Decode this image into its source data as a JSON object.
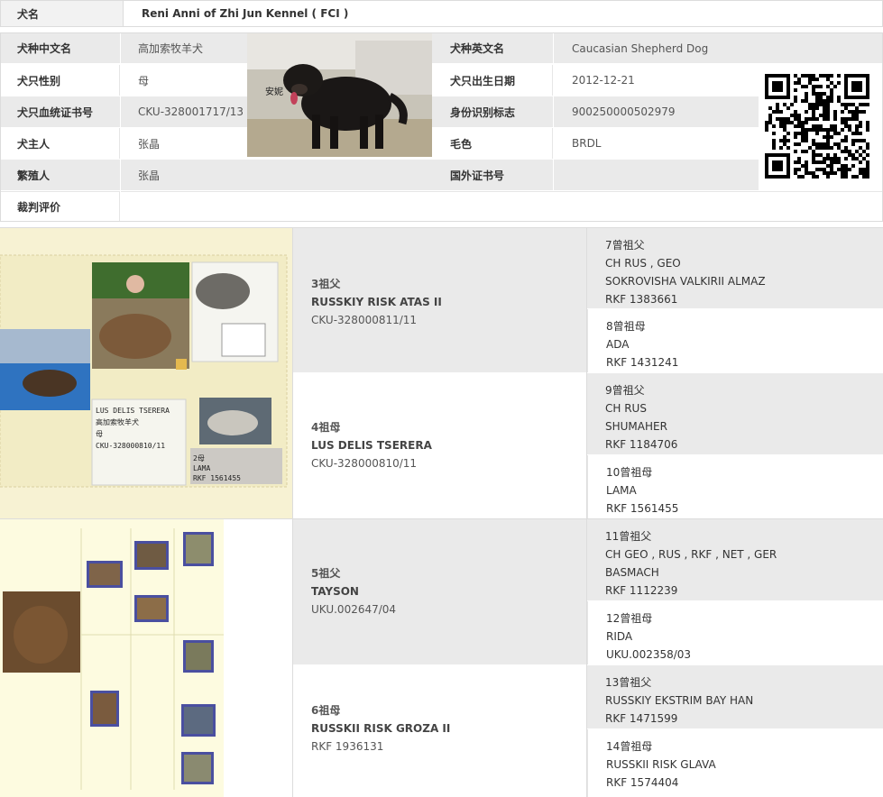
{
  "header": {
    "name_label": "犬名",
    "name_value": "Reni Anni of Zhi Jun Kennel ( FCI )"
  },
  "info": {
    "breed_cn_label": "犬种中文名",
    "breed_cn_value": "高加索牧羊犬",
    "breed_en_label": "犬种英文名",
    "breed_en_value": "Caucasian Shepherd Dog",
    "sex_label": "犬只性别",
    "sex_value": "母",
    "dob_label": "犬只出生日期",
    "dob_value": "2012-12-21",
    "reg_label": "犬只血统证书号",
    "reg_value": "CKU-328001717/13",
    "id_label": "身份识别标志",
    "id_value": "900250000502979",
    "owner_label": "犬主人",
    "owner_value": "张晶",
    "color_label": "毛色",
    "color_value": "BRDL",
    "breeder_label": "繁殖人",
    "breeder_value": "张晶",
    "foreign_label": "国外证书号",
    "foreign_value": "",
    "judge_label": "裁判评价",
    "judge_value": "",
    "photo_caption": "安妮"
  },
  "pedigree": {
    "grandparents": [
      {
        "rel": "3祖父",
        "name": "RUSSKIY RISK ATAS II",
        "reg": "CKU-328000811/11"
      },
      {
        "rel": "4祖母",
        "name": "LUS DELIS TSERERA",
        "reg": "CKU-328000810/11"
      },
      {
        "rel": "5祖父",
        "name": "TAYSON",
        "reg": "UKU.002647/04"
      },
      {
        "rel": "6祖母",
        "name": "RUSSKII RISK GROZA II",
        "reg": "RKF 1936131"
      }
    ],
    "great_grandparents": [
      {
        "rel": "7曾祖父",
        "title": "CH RUS , GEO",
        "name": "SOKROVISHA VALKIRII ALMAZ",
        "reg": "RKF 1383661"
      },
      {
        "rel": "8曾祖母",
        "title": "",
        "name": "ADA",
        "reg": "RKF 1431241"
      },
      {
        "rel": "9曾祖父",
        "title": "CH RUS",
        "name": "SHUMAHER",
        "reg": "RKF 1184706"
      },
      {
        "rel": "10曾祖母",
        "title": "",
        "name": "LAMA",
        "reg": "RKF 1561455"
      },
      {
        "rel": "11曾祖父",
        "title": "CH GEO , RUS , RKF , NET , GER",
        "name": "BASMACH",
        "reg": "RKF 1112239"
      },
      {
        "rel": "12曾祖母",
        "title": "",
        "name": "RIDA",
        "reg": "UKU.002358/03"
      },
      {
        "rel": "13曾祖父",
        "title": "",
        "name": "RUSSKIY EKSTRIM BAY HAN",
        "reg": "RKF 1471599"
      },
      {
        "rel": "14曾祖母",
        "title": "",
        "name": "RUSSKII RISK GLAVA",
        "reg": "RKF 1574404"
      }
    ]
  },
  "collage1": {
    "line1": "LUS DELIS TSERERA",
    "line2": "高加索牧羊犬",
    "line3": "母",
    "line4": "CKU-328000810/11",
    "mini_rel": "2母",
    "mini_name": "LAMA",
    "mini_reg": "RKF 1561455"
  },
  "colors": {
    "gray": "#eaeaea",
    "light_gray": "#f2f2f2",
    "border": "#dcdcdc",
    "collage_bg": "#f6f1cf"
  }
}
